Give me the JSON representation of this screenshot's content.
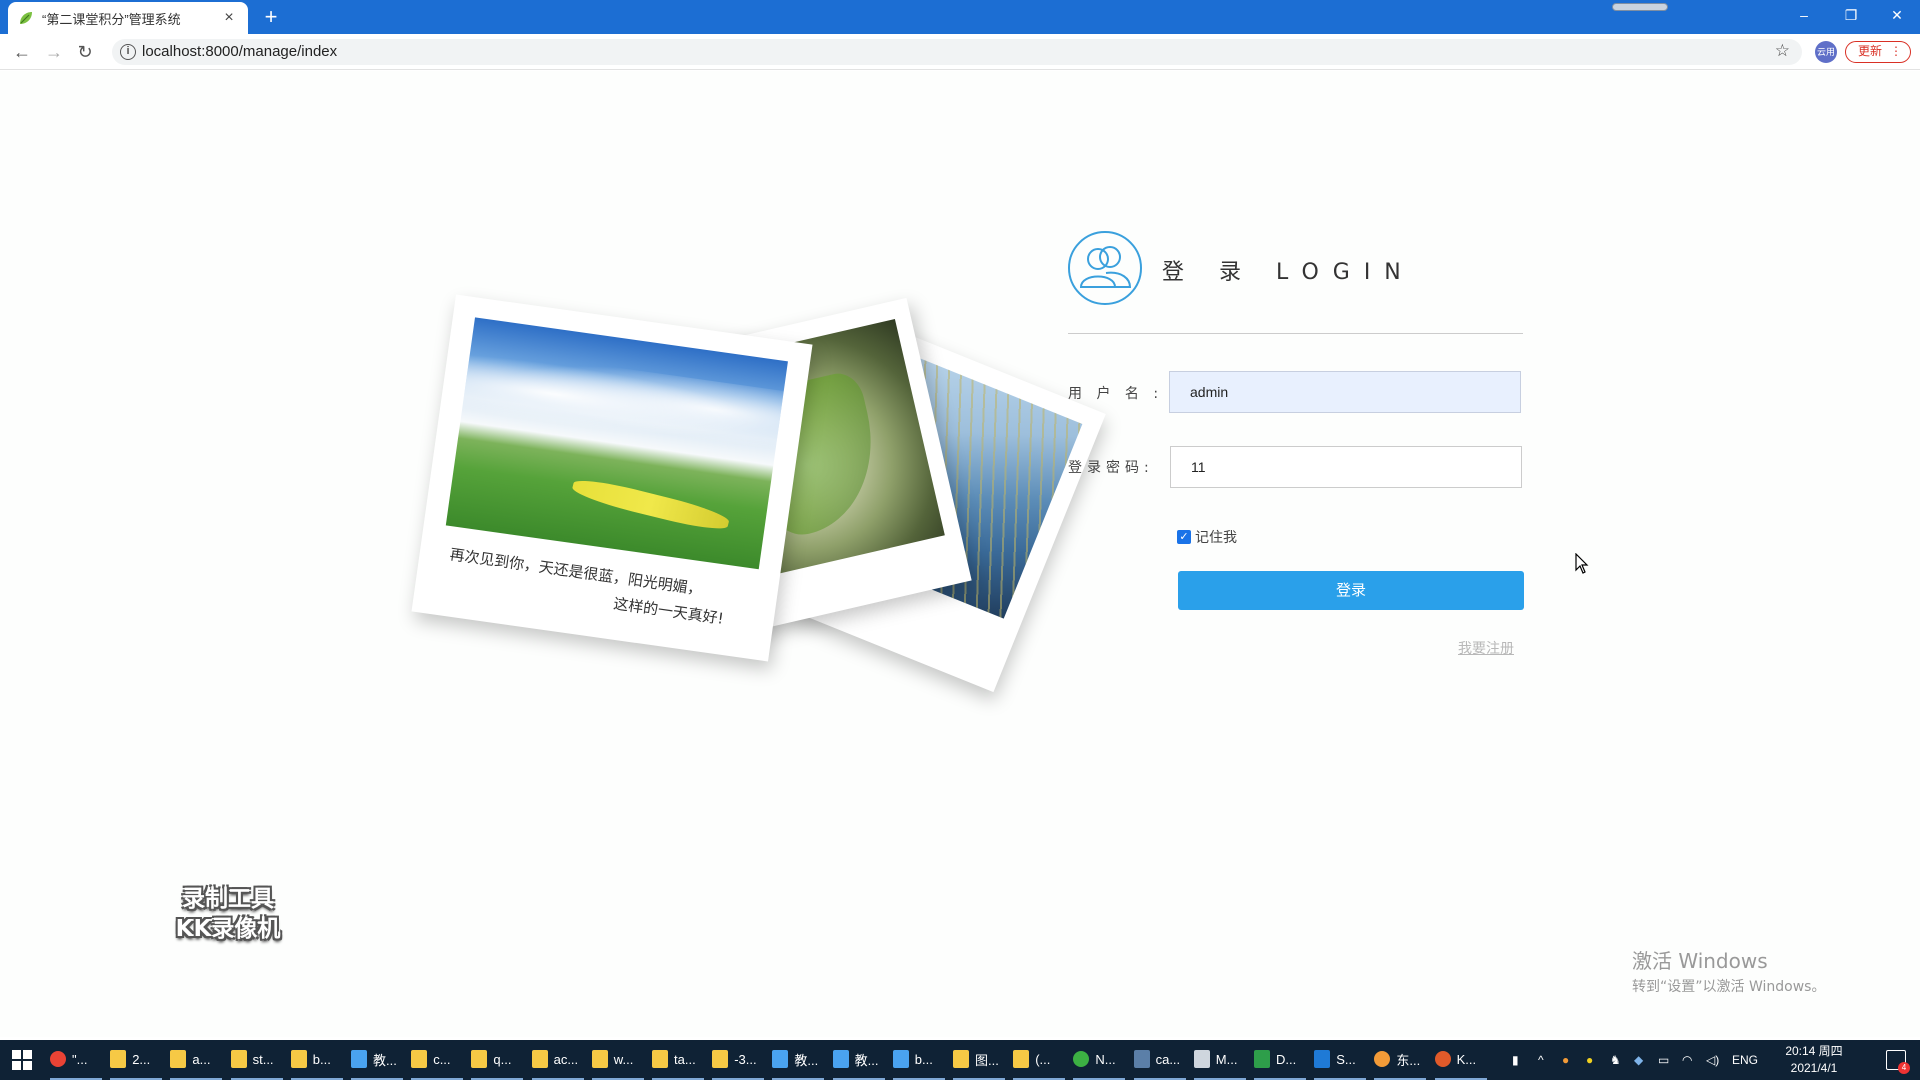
{
  "browser": {
    "tab_title": "“第二课堂积分”管理系统",
    "tab_close": "×",
    "new_tab": "+",
    "url": "localhost:8000/manage/index",
    "profile_label": "云用",
    "update_label": "更新",
    "update_dots": "⋮",
    "window_controls": {
      "minimize": "–",
      "maximize": "❐",
      "close": "✕"
    }
  },
  "login": {
    "title": "登 录 LOGIN",
    "username_label": "用 户 名 :",
    "username_value": "admin",
    "password_label": "登录密码:",
    "password_value": "11",
    "remember_label": "记住我",
    "remember_checked": true,
    "submit_label": "登录",
    "register_link": "我要注册"
  },
  "photo": {
    "caption_line1": "再次见到你，天还是很蓝，阳光明媚，",
    "caption_line2": "这样的一天真好!"
  },
  "overlay": {
    "recorder_line1": "录制工具",
    "recorder_line2": "KK录像机",
    "activate_line1": "激活 Windows",
    "activate_line2": "转到“设置”以激活 Windows。"
  },
  "taskbar": {
    "items": [
      {
        "label": "\"...",
        "icon": "chrome-icon",
        "color": "#ea4335"
      },
      {
        "label": "2...",
        "icon": "folder-icon",
        "color": "#f6c945"
      },
      {
        "label": "a...",
        "icon": "folder-icon",
        "color": "#f6c945"
      },
      {
        "label": "st...",
        "icon": "folder-icon",
        "color": "#f6c945"
      },
      {
        "label": "b...",
        "icon": "folder-icon",
        "color": "#f6c945"
      },
      {
        "label": "教...",
        "icon": "cube-icon",
        "color": "#4aa3f0"
      },
      {
        "label": "c...",
        "icon": "folder-icon",
        "color": "#f6c945"
      },
      {
        "label": "q...",
        "icon": "folder-icon",
        "color": "#f6c945"
      },
      {
        "label": "ac...",
        "icon": "folder-icon",
        "color": "#f6c945"
      },
      {
        "label": "w...",
        "icon": "folder-icon",
        "color": "#f6c945"
      },
      {
        "label": "ta...",
        "icon": "folder-icon",
        "color": "#f6c945"
      },
      {
        "label": "-3...",
        "icon": "folder-icon",
        "color": "#f6c945"
      },
      {
        "label": "教...",
        "icon": "cube-icon",
        "color": "#4aa3f0"
      },
      {
        "label": "教...",
        "icon": "cube-icon",
        "color": "#4aa3f0"
      },
      {
        "label": "b...",
        "icon": "cube-icon",
        "color": "#4aa3f0"
      },
      {
        "label": "图...",
        "icon": "folder-icon",
        "color": "#f6c945"
      },
      {
        "label": "(...",
        "icon": "folder-icon",
        "color": "#f6c945"
      },
      {
        "label": "N...",
        "icon": "leaf-icon",
        "color": "#3cb043"
      },
      {
        "label": "ca...",
        "icon": "calculator-icon",
        "color": "#5b7fa8"
      },
      {
        "label": "M...",
        "icon": "pen-icon",
        "color": "#cfd6de"
      },
      {
        "label": "D...",
        "icon": "document-icon",
        "color": "#2e9e4a"
      },
      {
        "label": "S...",
        "icon": "vscode-icon",
        "color": "#1f7ad6"
      },
      {
        "label": "东...",
        "icon": "chat-icon",
        "color": "#f29b38"
      },
      {
        "label": "K...",
        "icon": "recorder-icon",
        "color": "#e05a2a"
      }
    ],
    "lang": "ENG",
    "time": "20:14 周四",
    "date": "2021/4/1",
    "notification_count": "4"
  }
}
